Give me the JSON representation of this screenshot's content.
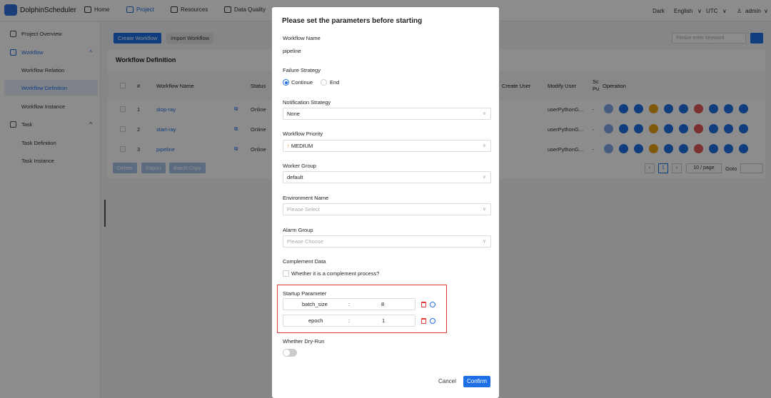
{
  "app": {
    "name": "DolphinScheduler"
  },
  "nav": {
    "home": "Home",
    "project": "Project",
    "resources": "Resources",
    "data_quality": "Data Quality"
  },
  "topright": {
    "theme": "Dark",
    "lang": "English",
    "tz": "UTC",
    "user": "admin"
  },
  "sidebar": {
    "items": [
      {
        "label": "Project Overview"
      },
      {
        "label": "Workflow"
      },
      {
        "label": "Workflow Relation"
      },
      {
        "label": "Workflow Definition"
      },
      {
        "label": "Workflow Instance"
      },
      {
        "label": "Task"
      },
      {
        "label": "Task Definition"
      },
      {
        "label": "Task Instance"
      }
    ]
  },
  "toolbar": {
    "create": "Create Workflow",
    "import": "Import Workflow",
    "search_placeholder": "Please enter keyword"
  },
  "card": {
    "title": "Workflow Definition"
  },
  "table": {
    "headers": [
      "#",
      "Workflow Name",
      "Status",
      "Create User",
      "Modify User",
      "Sc Pu",
      "Operation"
    ],
    "rows": [
      {
        "num": "1",
        "name": "stop-ray",
        "status": "Online",
        "modify": "userPythonG...",
        "dash": "-"
      },
      {
        "num": "2",
        "name": "start-ray",
        "status": "Online",
        "modify": "userPythonG...",
        "dash": "-"
      },
      {
        "num": "3",
        "name": "pipeline",
        "status": "Online",
        "modify": "userPythonG...",
        "dash": "-"
      }
    ],
    "bulk": {
      "delete": "Delete",
      "export": "Export",
      "batch_copy": "Batch Copy"
    },
    "pager": {
      "page": "1",
      "size": "10 / page",
      "goto": "Goto"
    }
  },
  "modal": {
    "title": "Please set the parameters before starting",
    "workflow_name_label": "Workflow Name",
    "workflow_name": "pipeline",
    "failure_label": "Failure Strategy",
    "failure_continue": "Continue",
    "failure_end": "End",
    "notification_label": "Notification Strategy",
    "notification_value": "None",
    "priority_label": "Workflow Priority",
    "priority_value": "MEDIUM",
    "worker_label": "Worker Group",
    "worker_value": "default",
    "env_label": "Environment Name",
    "env_placeholder": "Please Select",
    "alarm_label": "Alarm Group",
    "alarm_placeholder": "Please Choose",
    "complement_label": "Complement Data",
    "complement_check": "Whether it is a complement process?",
    "startup_label": "Startup Parameter",
    "params": [
      {
        "key": "batch_size",
        "sep": ":",
        "value": "8"
      },
      {
        "key": "epoch",
        "sep": ":",
        "value": "1"
      }
    ],
    "dryrun_label": "Whether Dry-Run",
    "cancel": "Cancel",
    "confirm": "Confirm"
  },
  "colors": {
    "accent": "#1e6fe6",
    "danger": "#e53935"
  }
}
